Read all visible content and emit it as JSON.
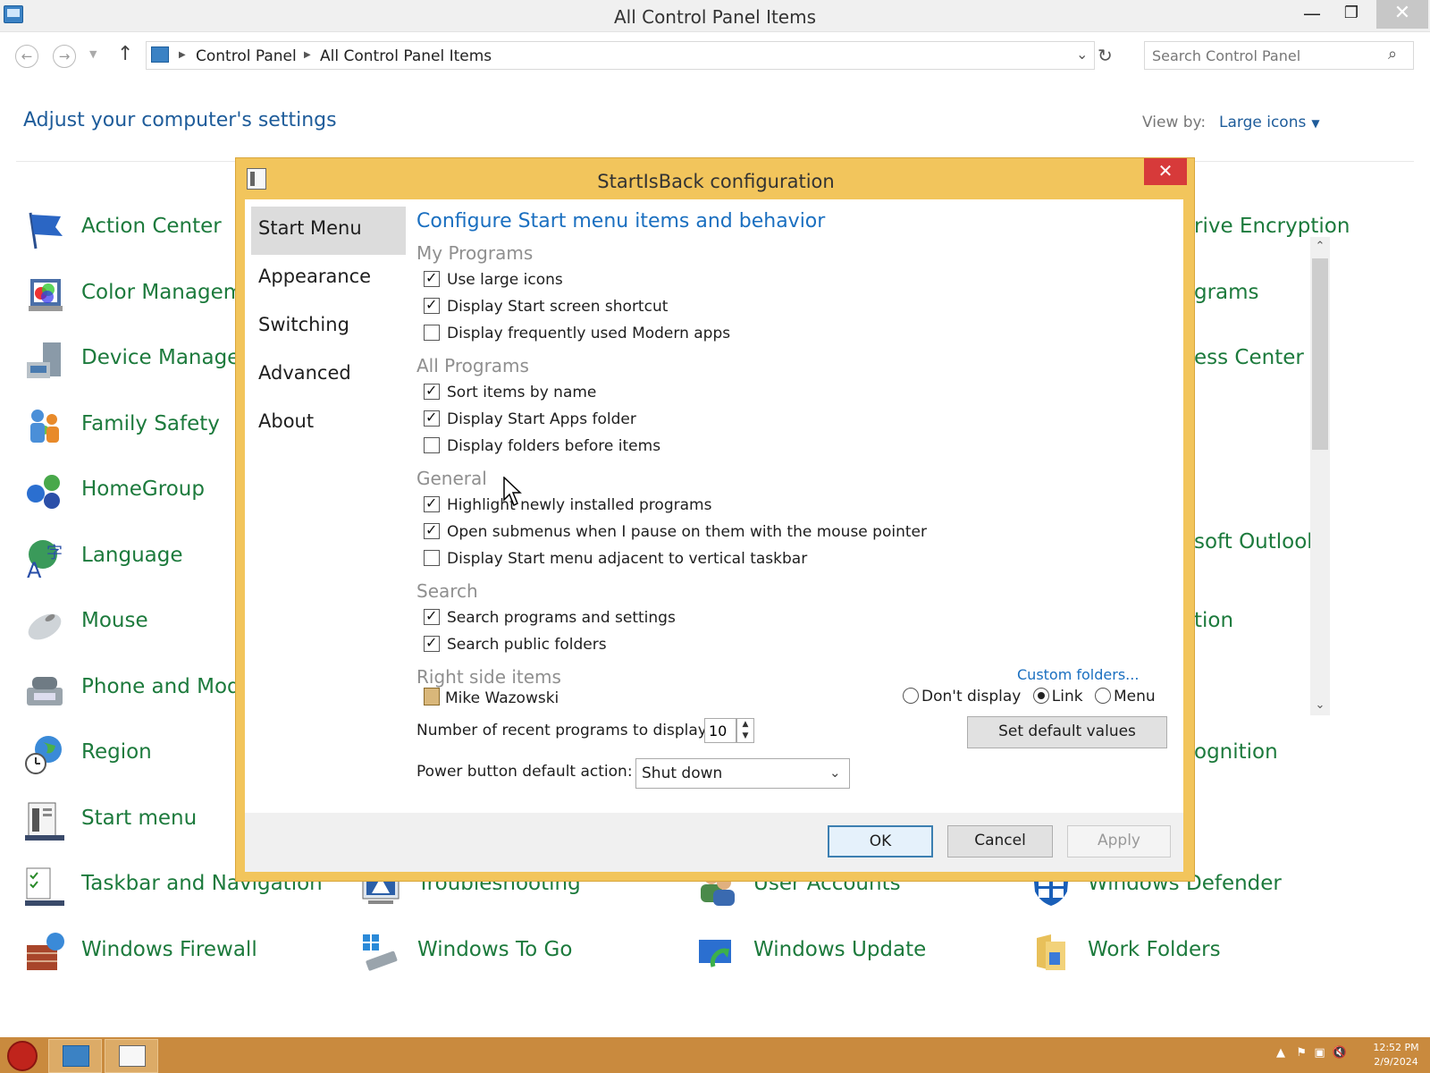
{
  "window": {
    "title": "All Control Panel Items",
    "minimize": "—",
    "maximize": "❐",
    "close": "✕"
  },
  "address": {
    "crumbs": [
      "Control Panel",
      "All Control Panel Items"
    ],
    "search_placeholder": "Search Control Panel"
  },
  "header": {
    "title": "Adjust your computer's settings",
    "view_by_label": "View by:",
    "view_by_value": "Large icons"
  },
  "control_panel_items": [
    {
      "label": "Action Center",
      "icon": "flag-icon"
    },
    {
      "label": "Color Managem",
      "icon": "color-management-icon"
    },
    {
      "label": "Device Manager",
      "icon": "device-manager-icon"
    },
    {
      "label": "Family Safety",
      "icon": "family-safety-icon"
    },
    {
      "label": "HomeGroup",
      "icon": "homegroup-icon"
    },
    {
      "label": "Language",
      "icon": "language-icon"
    },
    {
      "label": "Mouse",
      "icon": "mouse-icon"
    },
    {
      "label": "Phone and Mode",
      "icon": "phone-modem-icon"
    },
    {
      "label": "Region",
      "icon": "region-icon"
    },
    {
      "label": "Start menu",
      "icon": "start-menu-icon"
    },
    {
      "label": "Taskbar and Navigation",
      "icon": "taskbar-icon"
    },
    {
      "label": "Windows Firewall",
      "icon": "firewall-icon"
    },
    {
      "label": "rive Encryption",
      "icon": ""
    },
    {
      "label": "grams",
      "icon": ""
    },
    {
      "label": "ess Center",
      "icon": ""
    },
    {
      "label": "soft Outlook",
      "icon": ""
    },
    {
      "label": "tion",
      "icon": ""
    },
    {
      "label": "ognition",
      "icon": ""
    },
    {
      "label": "Troubleshooting",
      "icon": "troubleshooting-icon"
    },
    {
      "label": "User Accounts",
      "icon": "user-accounts-icon"
    },
    {
      "label": "Windows Defender",
      "icon": "windows-defender-icon"
    },
    {
      "label": "Windows To Go",
      "icon": "windows-to-go-icon"
    },
    {
      "label": "Windows Update",
      "icon": "windows-update-icon"
    },
    {
      "label": "Work Folders",
      "icon": "work-folders-icon"
    }
  ],
  "dialog": {
    "title": "StartIsBack configuration",
    "nav": [
      "Start Menu",
      "Appearance",
      "Switching",
      "Advanced",
      "About"
    ],
    "active_nav": "Start Menu",
    "heading": "Configure Start menu items and behavior",
    "sections": {
      "my_programs": {
        "title": "My Programs",
        "options": [
          {
            "label": "Use large icons",
            "checked": true
          },
          {
            "label": "Display Start screen shortcut",
            "checked": true
          },
          {
            "label": "Display frequently used Modern apps",
            "checked": false
          }
        ]
      },
      "all_programs": {
        "title": "All Programs",
        "options": [
          {
            "label": "Sort items by name",
            "checked": true
          },
          {
            "label": "Display Start Apps folder",
            "checked": true
          },
          {
            "label": "Display folders before items",
            "checked": false
          }
        ]
      },
      "general": {
        "title": "General",
        "options": [
          {
            "label": "Highlight newly installed programs",
            "checked": true
          },
          {
            "label": "Open submenus when I pause on them with the mouse pointer",
            "checked": true
          },
          {
            "label": "Display Start menu adjacent to vertical taskbar",
            "checked": false
          }
        ]
      },
      "search": {
        "title": "Search",
        "options": [
          {
            "label": "Search programs and settings",
            "checked": true
          },
          {
            "label": "Search public folders",
            "checked": true
          }
        ]
      },
      "right_side": {
        "title": "Right side items",
        "custom_folders_link": "Custom folders...",
        "item_label": "Mike Wazowski",
        "radio_options": [
          "Don't display",
          "Link",
          "Menu"
        ],
        "radio_selected": "Link"
      }
    },
    "recent_programs_label": "Number of recent programs to display:",
    "recent_programs_value": "10",
    "set_default_label": "Set default values",
    "power_label": "Power button default action:",
    "power_value": "Shut down",
    "ok_label": "OK",
    "cancel_label": "Cancel",
    "apply_label": "Apply"
  },
  "taskbar": {
    "time": "12:52 PM",
    "date": "2/9/2024"
  },
  "colors": {
    "accent_link": "#1a6fc0",
    "item_green": "#1c7a3c",
    "dialog_frame": "#f2c55c",
    "taskbar": "#c98a3e"
  }
}
